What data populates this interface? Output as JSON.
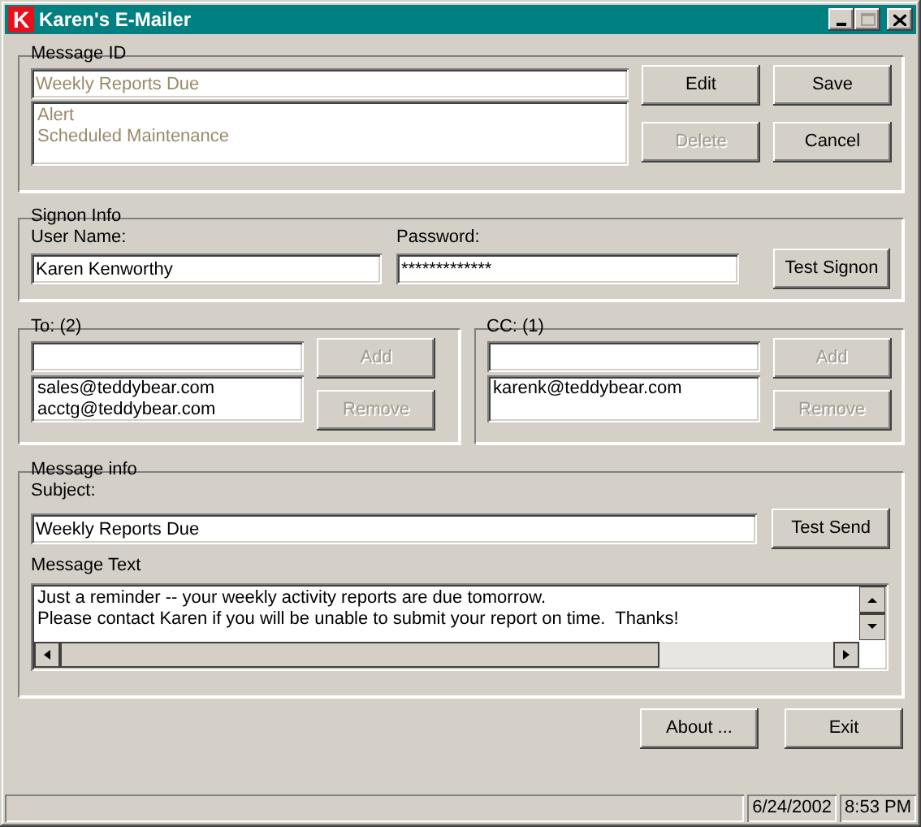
{
  "window": {
    "icon_letter": "K",
    "title": "Karen's E-Mailer"
  },
  "message_id": {
    "label": "Message ID",
    "value": "Weekly Reports Due",
    "disabled": true,
    "list": [
      "Alert",
      "Scheduled Maintenance"
    ],
    "buttons": [
      {
        "label": "Edit",
        "disabled": false
      },
      {
        "label": "Save",
        "disabled": false
      },
      {
        "label": "Delete",
        "disabled": true
      },
      {
        "label": "Cancel",
        "disabled": false
      }
    ]
  },
  "signon": {
    "label": "Signon Info",
    "fields": [
      {
        "label": "User Name:",
        "value": "Karen Kenworthy"
      },
      {
        "label": "Password:",
        "value": "*************"
      }
    ],
    "button": {
      "label": "Test Signon",
      "disabled": false
    }
  },
  "recipients": [
    {
      "label": "To: (2)",
      "entries": [
        "sales@teddybear.com",
        "acctg@teddybear.com"
      ],
      "buttons": [
        {
          "label": "Add",
          "disabled": true
        },
        {
          "label": "Remove",
          "disabled": true
        }
      ]
    },
    {
      "label": "CC: (1)",
      "entries": [
        "karenk@teddybear.com"
      ],
      "buttons": [
        {
          "label": "Add",
          "disabled": true
        },
        {
          "label": "Remove",
          "disabled": true
        }
      ]
    }
  ],
  "message_info": {
    "label": "Message info",
    "subject_label": "Subject:",
    "subject": "Weekly Reports Due",
    "button": {
      "label": "Test Send",
      "disabled": false
    },
    "text_label": "Message Text",
    "text_lines": [
      "Just a reminder -- your weekly activity reports are due tomorrow.",
      "Please contact Karen if you will be unable to submit your report on time.  Thanks!"
    ]
  },
  "footer_buttons": [
    {
      "label": "About ...",
      "disabled": false
    },
    {
      "label": "Exit",
      "disabled": false
    }
  ],
  "status_bar": {
    "date": "6/24/2002",
    "time": "8:53 PM"
  }
}
